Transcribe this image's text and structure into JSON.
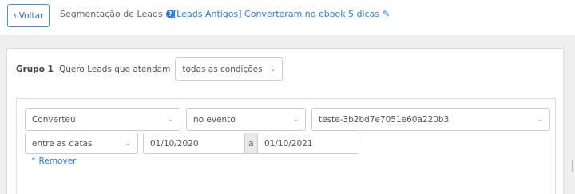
{
  "header": {
    "back_label": "Voltar",
    "back_icon": "chevron-left-icon",
    "title": "Segmentação de Leads",
    "help_icon": "question-circle-icon",
    "segment_name": "[Leads Antigos] Converteram no ebook 5 dicas",
    "edit_icon": "pencil-icon"
  },
  "group": {
    "label": "Grupo 1",
    "description": "Quero Leads que atendam",
    "match_select": "todas as condições"
  },
  "condition": {
    "field_select": "Converteu",
    "operator_select": "no evento",
    "event_select": "teste-3b2bd7e7051e60a220b3",
    "date_mode_select": "entre as datas",
    "date_start": "01/10/2020",
    "date_separator": "a",
    "date_end": "01/10/2021",
    "remove_label": "Remover"
  },
  "colors": {
    "accent": "#2a7fd4",
    "band": "#efefef",
    "border": "#cccccc"
  }
}
